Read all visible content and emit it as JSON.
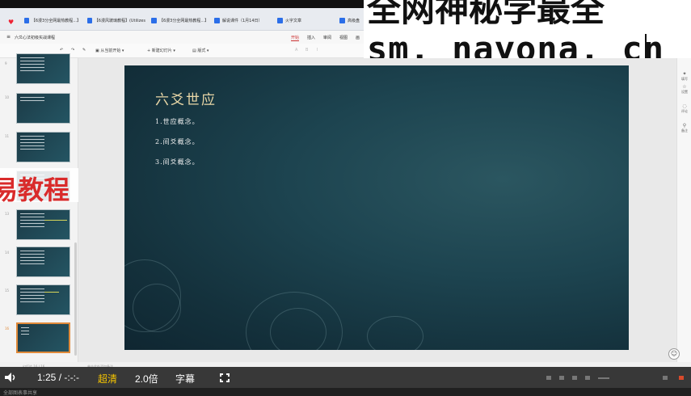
{
  "browser": {
    "tabs": [
      {
        "label": "【6漫3分全网最热教程...】"
      },
      {
        "label": "【6漫风玻璃教程】(Utilizes"
      },
      {
        "label": "【6漫3分全网最热教程...】"
      },
      {
        "label": "解说课件（1月14日）"
      },
      {
        "label": "火字文章"
      },
      {
        "label": "高级盘"
      }
    ]
  },
  "app": {
    "doc_title": "六爻心法初级实战课程",
    "menu_tabs": [
      "开始",
      "插入",
      "审阅",
      "视图",
      "画"
    ],
    "active_tab": "开始",
    "toolbar": {
      "from_current": "从当前开始",
      "new_slide": "新建幻灯片",
      "layout": "版式"
    }
  },
  "watermark": {
    "line1": "全网神秘学最全",
    "line2": "sm. nayona. cn"
  },
  "red_banner": {
    "text": "易教程"
  },
  "thumbnails": {
    "numbers": [
      "9",
      "10",
      "11",
      "12",
      "13",
      "14",
      "15",
      "16"
    ],
    "selected_index": 7
  },
  "slide": {
    "title": "六爻世应",
    "items": [
      "1.世应概念。",
      "2.间爻概念。",
      "3.间爻概念。"
    ]
  },
  "right_sidebar": {
    "items": [
      "填写",
      "设置",
      "评论",
      "备注"
    ]
  },
  "status": {
    "left": "幻灯片 16 / 16",
    "center": "单击此处添加备注"
  },
  "player": {
    "time": "1:25 / -:-:-",
    "quality": "超清",
    "speed": "2.0倍",
    "subtitle": "字幕"
  },
  "footer": {
    "text": "全部图表事共享"
  }
}
